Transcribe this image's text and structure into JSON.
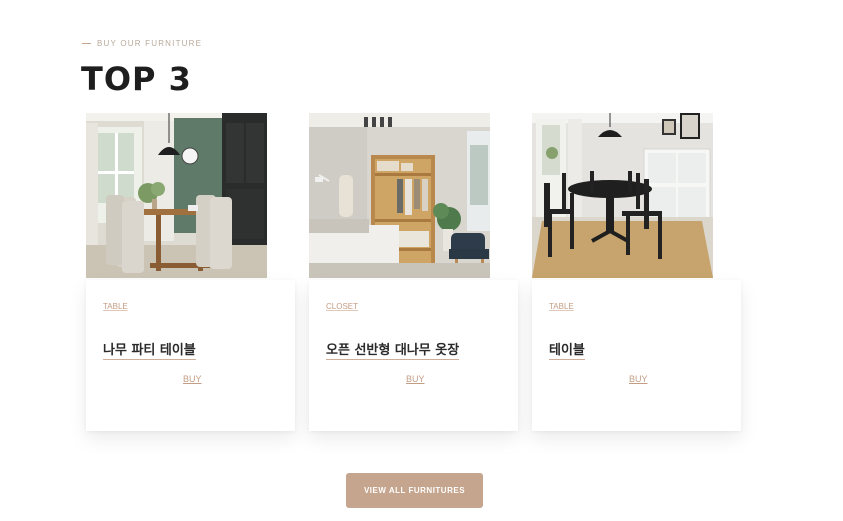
{
  "section": {
    "eyebrow": "BUY OUR FURNITURE",
    "title": "TOP 3"
  },
  "products": [
    {
      "category": "TABLE",
      "name": "나무 파티 테이블",
      "buy_label": "BUY"
    },
    {
      "category": "CLOSET",
      "name": "오픈 선반형 대나무 옷장",
      "buy_label": "BUY"
    },
    {
      "category": "TABLE",
      "name": "테이블",
      "buy_label": "BUY"
    }
  ],
  "cta": {
    "label": "VIEW ALL FURNITURES"
  },
  "colors": {
    "accent": "#c5a58d",
    "category_text": "#c49d85",
    "title_text": "#1e1e1e"
  }
}
